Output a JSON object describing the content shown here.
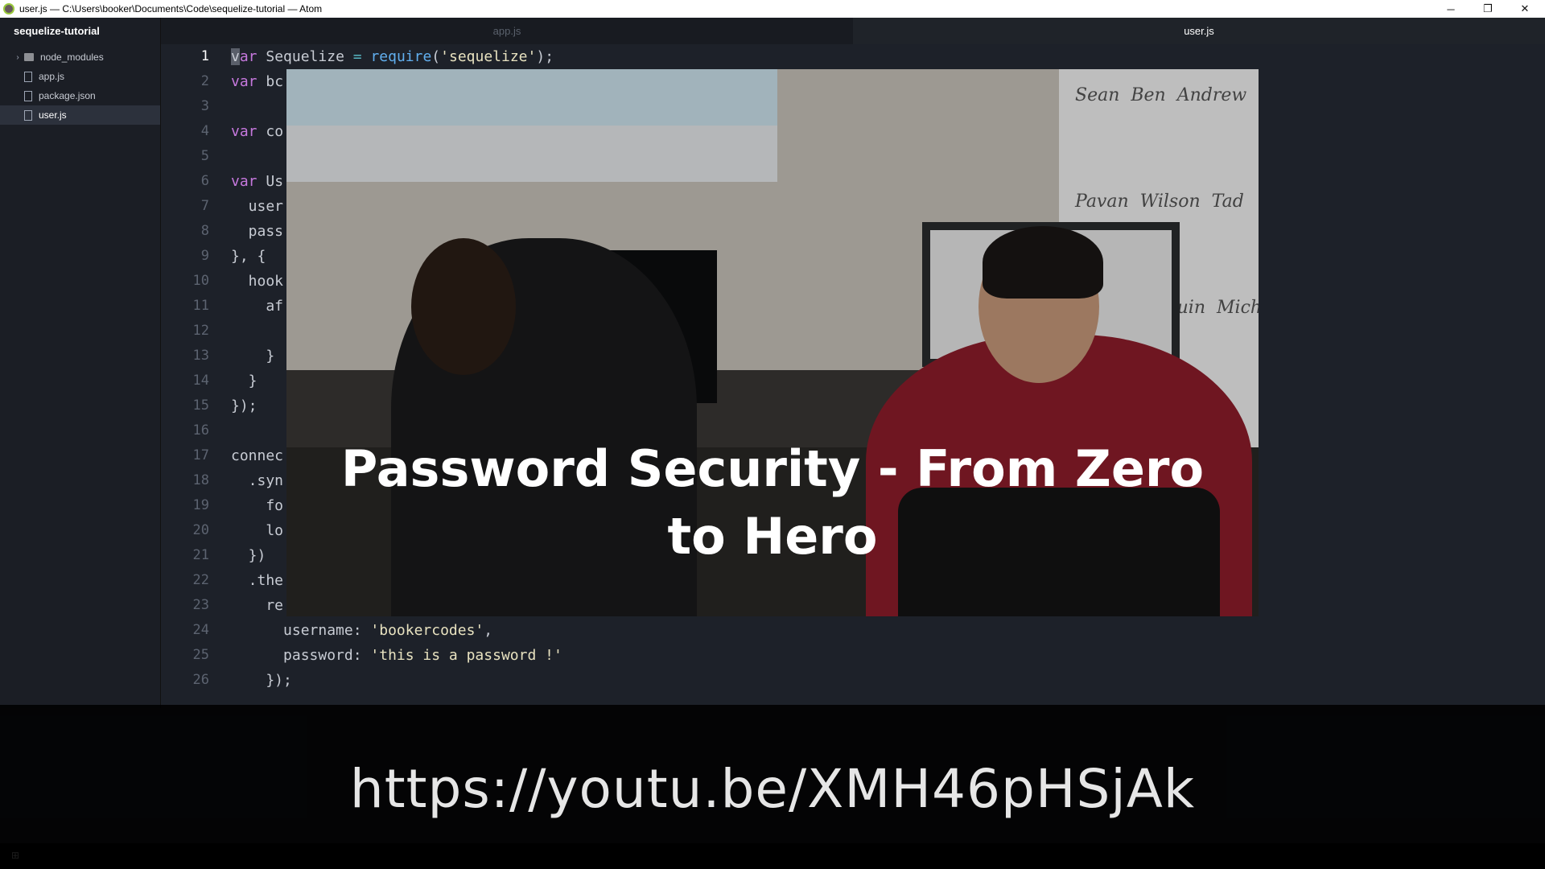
{
  "window": {
    "title": "user.js — C:\\Users\\booker\\Documents\\Code\\sequelize-tutorial — Atom",
    "controls": {
      "minimize": "─",
      "restore": "❐",
      "close": "✕"
    }
  },
  "sidebar": {
    "project": "sequelize-tutorial",
    "items": [
      {
        "label": "node_modules",
        "icon": "folder-icon"
      },
      {
        "label": "app.js",
        "icon": "file-icon"
      },
      {
        "label": "package.json",
        "icon": "file-icon"
      },
      {
        "label": "user.js",
        "icon": "file-icon",
        "selected": true
      }
    ]
  },
  "tabs": [
    {
      "label": "app.js",
      "active": false
    },
    {
      "label": "user.js",
      "active": true
    }
  ],
  "editor": {
    "current_line": 1,
    "line_numbers": [
      "1",
      "2",
      "3",
      "4",
      "5",
      "6",
      "7",
      "8",
      "9",
      "10",
      "11",
      "12",
      "13",
      "14",
      "15",
      "16",
      "17",
      "18",
      "19",
      "20",
      "21",
      "22",
      "23",
      "24",
      "25",
      "26"
    ],
    "lines": [
      "var Sequelize = require('sequelize');",
      "var bc",
      "",
      "var co",
      "",
      "var Us",
      "  user",
      "  pass",
      "}, {",
      "  hook",
      "    af",
      "",
      "    }",
      "  }",
      "});",
      "",
      "connec",
      "  .syn",
      "    fo",
      "    lo",
      "  })",
      "  .the",
      "    re",
      "      username: 'bookercodes',",
      "      password: 'this is a password !'",
      "    });"
    ]
  },
  "video": {
    "title": "Password Security - From Zero to Hero",
    "whiteboard_names": "Sean  Ben  Andrew\n\nPavan  Wilson  Tad\n\nWillie  Joaquin  Michael\n\n                   Kevin\n\n                   Greg"
  },
  "overlay": {
    "url": "https://youtu.be/XMH46pHSjAk"
  },
  "colors": {
    "editor_bg": "#1d2129",
    "keyword": "#c678dd",
    "function": "#61afef",
    "string": "#e8e2c0",
    "operator": "#56b6c2"
  }
}
